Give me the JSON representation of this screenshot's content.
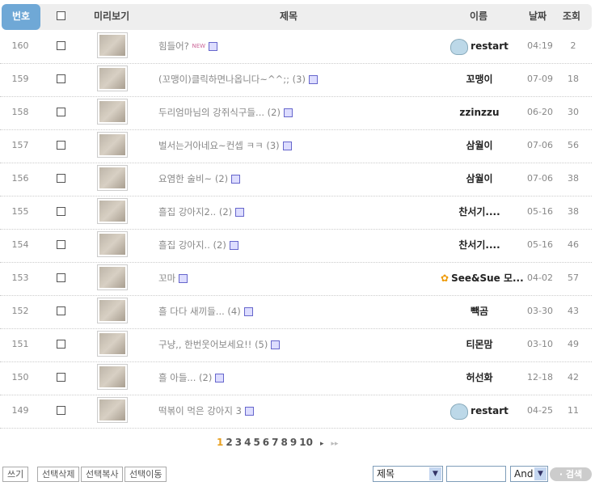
{
  "header": {
    "no": "번호",
    "preview": "미리보기",
    "title": "제목",
    "name": "이름",
    "date": "날짜",
    "views": "조회"
  },
  "rows": [
    {
      "no": "160",
      "title": "힘들어?",
      "comments": "",
      "new": "NEW",
      "name": "restart",
      "icon": true,
      "date": "04:19",
      "views": "2"
    },
    {
      "no": "159",
      "title": "(꼬맹이)클릭하면나옵니다~^^;;",
      "comments": "(3)",
      "name": "꼬맹이",
      "date": "07-09",
      "views": "18"
    },
    {
      "no": "158",
      "title": "두리엄마님의 강쥐식구들...",
      "comments": "(2)",
      "name": "zzinzzu",
      "date": "06-20",
      "views": "30"
    },
    {
      "no": "157",
      "title": "벌서는거아네요~컨셉 ㅋㅋ",
      "comments": "(3)",
      "name": "삼월이",
      "date": "07-06",
      "views": "56"
    },
    {
      "no": "156",
      "title": "요염한 술비~",
      "comments": "(2)",
      "name": "삼월이",
      "date": "07-06",
      "views": "38"
    },
    {
      "no": "155",
      "title": "흘집 강아지2..",
      "comments": "(2)",
      "name": "찬서기....",
      "date": "05-16",
      "views": "38"
    },
    {
      "no": "154",
      "title": "흘집 강아지..",
      "comments": "(2)",
      "name": "찬서기....",
      "date": "05-16",
      "views": "46"
    },
    {
      "no": "153",
      "title": "꼬마",
      "comments": "",
      "name": "See&Sue 모...",
      "icon2": true,
      "date": "04-02",
      "views": "57"
    },
    {
      "no": "152",
      "title": "흘 다다 새끼들...",
      "comments": "(4)",
      "name": "빽곰",
      "date": "03-30",
      "views": "43"
    },
    {
      "no": "151",
      "title": "구냥,, 한번웃어보세요!!",
      "comments": "(5)",
      "name": "티몬맘",
      "date": "03-10",
      "views": "49"
    },
    {
      "no": "150",
      "title": "흘 아들...",
      "comments": "(2)",
      "name": "허선화",
      "date": "12-18",
      "views": "42"
    },
    {
      "no": "149",
      "title": "떡볶이 먹은 강아지 3",
      "comments": "",
      "name": "restart",
      "icon": true,
      "date": "04-25",
      "views": "11"
    }
  ],
  "pagination": {
    "pages": [
      "1",
      "2",
      "3",
      "4",
      "5",
      "6",
      "7",
      "8",
      "9",
      "10"
    ],
    "current": "1",
    "next": "▸",
    "last": "▸▸"
  },
  "buttons": {
    "write": "쓰기",
    "delete": "선택삭제",
    "copy": "선택복사",
    "move": "선택이동"
  },
  "search": {
    "field": "제목",
    "query": "",
    "op": "And",
    "submit": "· 검색"
  }
}
